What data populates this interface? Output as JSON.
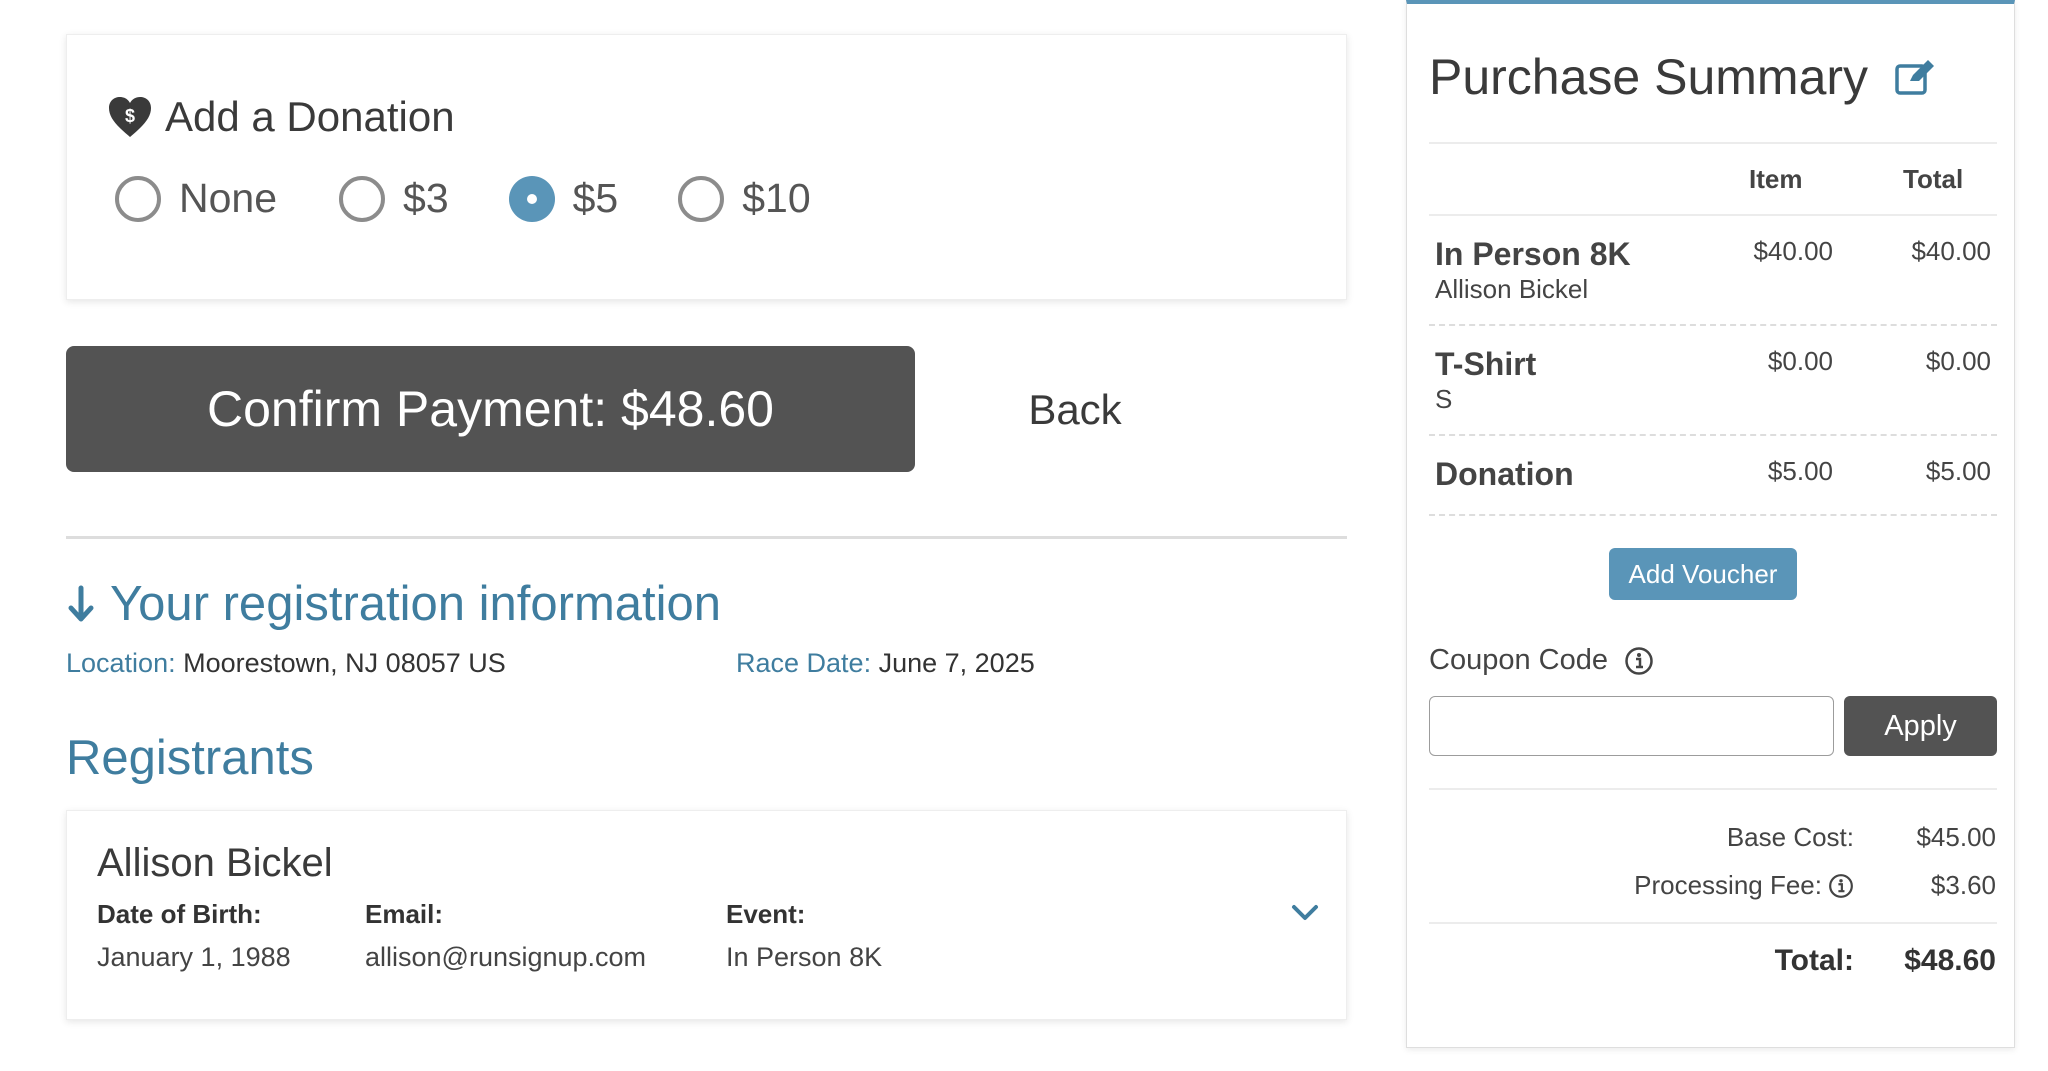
{
  "donation": {
    "title": "Add a Donation",
    "options": [
      {
        "label": "None",
        "selected": false
      },
      {
        "label": "$3",
        "selected": false
      },
      {
        "label": "$5",
        "selected": true
      },
      {
        "label": "$10",
        "selected": false
      }
    ]
  },
  "actions": {
    "confirm_label": "Confirm Payment: $48.60",
    "back_label": "Back"
  },
  "registration": {
    "heading": "Your registration information",
    "location_label": "Location:",
    "location_value": "Moorestown, NJ 08057 US",
    "race_date_label": "Race Date:",
    "race_date_value": "June 7, 2025"
  },
  "registrants": {
    "title": "Registrants",
    "items": [
      {
        "name": "Allison Bickel",
        "dob_label": "Date of Birth:",
        "dob_value": "January 1, 1988",
        "email_label": "Email:",
        "email_value": "allison@runsignup.com",
        "event_label": "Event:",
        "event_value": "In Person 8K"
      }
    ]
  },
  "summary": {
    "title": "Purchase Summary",
    "col_item": "Item",
    "col_total": "Total",
    "rows": [
      {
        "name": "In Person 8K",
        "sub": "Allison Bickel",
        "item": "$40.00",
        "total": "$40.00"
      },
      {
        "name": "T-Shirt",
        "sub": "S",
        "item": "$0.00",
        "total": "$0.00"
      },
      {
        "name": "Donation",
        "sub": "",
        "item": "$5.00",
        "total": "$5.00"
      }
    ],
    "voucher_label": "Add Voucher",
    "coupon_label": "Coupon Code",
    "coupon_value": "",
    "coupon_placeholder": "",
    "apply_label": "Apply",
    "base_cost_label": "Base Cost:",
    "base_cost_value": "$45.00",
    "processing_fee_label": "Processing Fee:",
    "processing_fee_value": "$3.60",
    "total_label": "Total:",
    "total_value": "$48.60"
  },
  "colors": {
    "accent": "#5a95b8",
    "link": "#3f7d9f",
    "dark_button": "#535353"
  }
}
